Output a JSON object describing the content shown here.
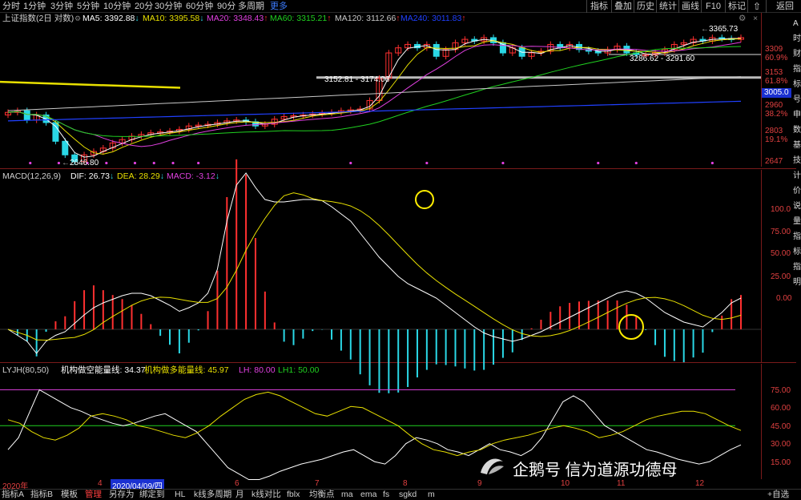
{
  "toolbar": {
    "periods": [
      "分时",
      "1分钟",
      "3分钟",
      "5分钟",
      "10分钟",
      "20分",
      "30分钟",
      "60分钟",
      "90分",
      "多周期"
    ],
    "more": "更多",
    "right_buttons": [
      "指标",
      "叠加",
      "历史",
      "统计",
      "画线",
      "F10",
      "标记"
    ]
  },
  "main_legend": {
    "title": "上证指数(2日 对数)",
    "ma5": "MA5: 3392.88",
    "ma10": "MA10: 3395.58",
    "ma20": "MA20: 3348.43",
    "ma60": "MA60: 3315.21",
    "ma120": "MA120: 3112.66",
    "ma240": "MA240: 3011.83"
  },
  "main_annotations": {
    "high": "3365.73",
    "range1": "3286.62 - 3291.60",
    "range2": "3152.81 - 3174.06",
    "low": "2646.80"
  },
  "main_axis": [
    "3309",
    "60.9%",
    "3153",
    "61.8%",
    "3005.0",
    "2960",
    "38.2%",
    "2803",
    "19.1%",
    "2647"
  ],
  "right_side_chars": [
    "A",
    "时",
    "财",
    "指",
    "标",
    "号",
    "申",
    "数",
    "基",
    "技",
    "计",
    "价",
    "说",
    "量",
    "指",
    "标",
    "指",
    "明"
  ],
  "macd_legend": {
    "name": "MACD(12,26,9)",
    "dif": "DIF: 26.73",
    "dea": "DEA: 28.29",
    "macd": "MACD: -3.12"
  },
  "macd_axis": [
    "100.0",
    "75.00",
    "50.00",
    "25.00",
    "0.00"
  ],
  "lyjh_legend": {
    "name": "LYJH(80,50)",
    "short": "机构做空能量线: 34.37",
    "long": "机构做多能量线: 45.97",
    "lh": "LH: 80.00",
    "lh1": "LH1: 50.00"
  },
  "lyjh_axis": [
    "75.00",
    "60.00",
    "45.00",
    "30.00",
    "15.00"
  ],
  "time_axis": {
    "year": "2020年",
    "m4": "4",
    "selected": "2020/04/09/四",
    "m6": "6",
    "m7": "7",
    "m8": "8",
    "m9": "9",
    "m10": "10",
    "m11": "11",
    "m12": "12"
  },
  "bottom_tabs": [
    "指标A",
    "指标B",
    "模板",
    "管理",
    "另存为",
    "绑定到",
    "HL",
    "k线多周期",
    "月",
    "k线对比",
    "fblx",
    "均衡点",
    "ma",
    "ema",
    "fs",
    "sgkd",
    "m"
  ],
  "bottom_right": "+自选",
  "nav_icons": {
    "back": "返回",
    "close": "x"
  },
  "watermark": "企鹅号 信为道源功德母",
  "colors": {
    "up": "#ff3030",
    "down": "#2ad8e6",
    "ma5": "#ffffff",
    "ma10": "#e8e000",
    "ma20": "#e040e0",
    "ma60": "#20d020",
    "ma120": "#c8c8c8",
    "ma240": "#2040ff"
  },
  "chart_data": [
    {
      "type": "line",
      "title": "上证指数(2日 对数)",
      "series": [
        {
          "name": "MA5",
          "last": 3392.88
        },
        {
          "name": "MA10",
          "last": 3395.58
        },
        {
          "name": "MA20",
          "last": 3348.43
        },
        {
          "name": "MA60",
          "last": 3315.21
        },
        {
          "name": "MA120",
          "last": 3112.66
        },
        {
          "name": "MA240",
          "last": 3011.83
        }
      ],
      "close_series": [
        2950,
        2960,
        2905,
        2935,
        2890,
        2780,
        2700,
        2660,
        2700,
        2720,
        2740,
        2770,
        2790,
        2810,
        2820,
        2830,
        2835,
        2840,
        2850,
        2870,
        2875,
        2880,
        2890,
        2900,
        2905,
        2895,
        2870,
        2880,
        2910,
        2925,
        2930,
        2935,
        2940,
        2945,
        2950,
        2960,
        2965,
        2970,
        3020,
        3150,
        3300,
        3330,
        3350,
        3330,
        3350,
        3280,
        3320,
        3360,
        3380,
        3370,
        3390,
        3360,
        3300,
        3330,
        3280,
        3300,
        3310,
        3350,
        3330,
        3350,
        3320,
        3310,
        3300,
        3320,
        3340,
        3300,
        3290,
        3290,
        3300,
        3320,
        3350,
        3360,
        3380,
        3370,
        3390,
        3385,
        3380,
        3390
      ],
      "ylim": [
        2640,
        3470
      ]
    },
    {
      "type": "bar",
      "title": "MACD(12,26,9)",
      "dif_last": 26.73,
      "dea_last": 28.29,
      "macd_last": -3.12,
      "ylim": [
        -30,
        130
      ]
    },
    {
      "type": "line",
      "title": "LYJH(80,50)",
      "series": [
        {
          "name": "机构做空能量线",
          "last": 34.37
        },
        {
          "name": "机构做多能量线",
          "last": 45.97
        }
      ],
      "lh": 80.0,
      "lh1": 50.0,
      "ylim": [
        0,
        95
      ]
    }
  ]
}
